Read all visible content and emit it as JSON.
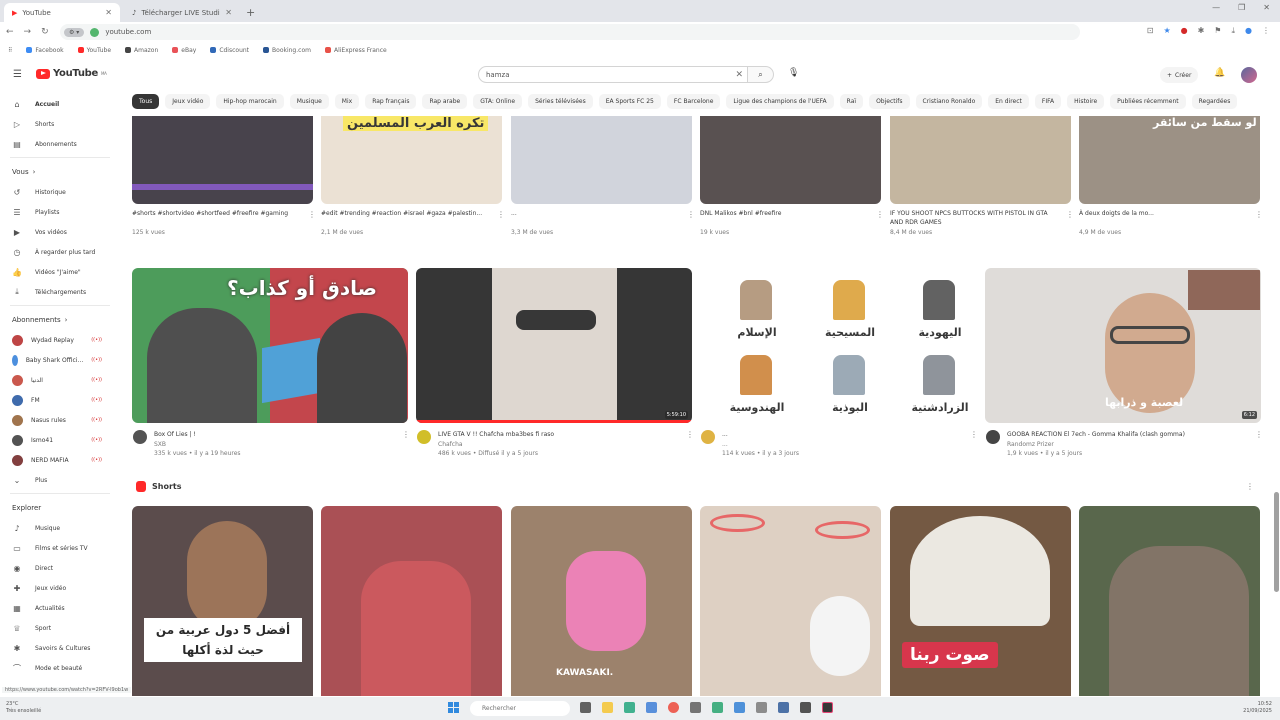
{
  "browser": {
    "tabs": [
      {
        "label": "YouTube",
        "active": true
      },
      {
        "label": "Télécharger LIVE Studio | TikTok",
        "active": false
      }
    ],
    "url": "youtube.com",
    "bookmarks": [
      "Facebook",
      "YouTube",
      "Amazon",
      "eBay",
      "Cdiscount",
      "Booking.com",
      "AliExpress France"
    ],
    "status_url": "https://www.youtube.com/watch?v=2RFV-l9ob1w"
  },
  "youtube": {
    "logo": "YouTube",
    "logo_region": "MA",
    "search_value": "hamza",
    "create_label": "Créer",
    "chips": [
      "Tous",
      "Jeux vidéo",
      "Hip-hop marocain",
      "Musique",
      "Mix",
      "Rap français",
      "Rap arabe",
      "GTA: Online",
      "Séries télévisées",
      "EA Sports FC 25",
      "FC Barcelone",
      "Ligue des champions de l'UEFA",
      "Raï",
      "Objectifs",
      "Cristiano Ronaldo",
      "En direct",
      "FIFA",
      "Histoire",
      "Publiées récemment",
      "Regardées"
    ]
  },
  "sidebar": {
    "main": [
      {
        "label": "Accueil",
        "icon": "home-icon",
        "active": true
      },
      {
        "label": "Shorts",
        "icon": "shorts-icon"
      },
      {
        "label": "Abonnements",
        "icon": "subscriptions-icon"
      }
    ],
    "you_header": "Vous",
    "you": [
      {
        "label": "Historique",
        "icon": "history-icon"
      },
      {
        "label": "Playlists",
        "icon": "playlist-icon"
      },
      {
        "label": "Vos vidéos",
        "icon": "video-icon"
      },
      {
        "label": "À regarder plus tard",
        "icon": "clock-icon"
      },
      {
        "label": "Vidéos \"J'aime\"",
        "icon": "like-icon"
      },
      {
        "label": "Téléchargements",
        "icon": "download-icon"
      }
    ],
    "subs_header": "Abonnements",
    "subs": [
      {
        "label": "Wydad Replay",
        "color": "#b22222"
      },
      {
        "label": "Baby Shark Offici...",
        "color": "#2a7ad8"
      },
      {
        "label": "الدنيا",
        "color": "#c0392b"
      },
      {
        "label": "FM",
        "color": "#1b4f9c"
      },
      {
        "label": "Nasus rules",
        "color": "#8e5a2b"
      },
      {
        "label": "Ismo41",
        "color": "#333333"
      },
      {
        "label": "NERD MAFIA",
        "color": "#6a1b1b"
      }
    ],
    "more_label": "Plus",
    "explore_header": "Explorer",
    "explore": [
      {
        "label": "Musique",
        "icon": "music-icon"
      },
      {
        "label": "Films et séries TV",
        "icon": "film-icon"
      },
      {
        "label": "Direct",
        "icon": "live-icon"
      },
      {
        "label": "Jeux vidéo",
        "icon": "gamepad-icon"
      },
      {
        "label": "Actualités",
        "icon": "news-icon"
      },
      {
        "label": "Sport",
        "icon": "trophy-icon"
      },
      {
        "label": "Savoirs & Cultures",
        "icon": "bulb-icon"
      },
      {
        "label": "Mode et beauté",
        "icon": "hanger-icon"
      }
    ]
  },
  "row1": [
    {
      "title": "#shorts #shortvideo #shortfeed #freefire #gaming",
      "views": "125 k vues",
      "thumb_text": "",
      "bg": "#26202a"
    },
    {
      "title": "#edit #trending #reaction #israel #gaza #palestin...",
      "views": "2,1 M de vues",
      "thumb_text": "تكره العرب المسلمين",
      "bg": "#e8dccc"
    },
    {
      "title": "...",
      "views": "3,3 M de vues",
      "thumb_text": "",
      "bg": "#c9ccd6"
    },
    {
      "title": "DNL Malikos #bnl #freefire",
      "views": "19 k vues",
      "thumb_text": "",
      "bg": "#3a3030"
    },
    {
      "title": "IF YOU SHOOT NPCS BUTTOCKS WITH PISTOL IN GTA AND RDR GAMES",
      "views": "8,4 M de vues",
      "thumb_text": "",
      "bg": "#b9a88e"
    },
    {
      "title": "À deux doigts de la mo...",
      "views": "4,9 M de vues",
      "thumb_text": "لو سقط من سائقر",
      "bg": "#8a7d6e"
    }
  ],
  "row2": [
    {
      "title": "Box Of Lies | !",
      "channel": "SXB",
      "views": "335 k vues • il y a 19 heures",
      "duration": "",
      "thumb_text": "صادق أو كذاب؟",
      "bg": "#2c8a3c",
      "av": "#333"
    },
    {
      "title": "LIVE GTA V !! Chafcha mba3bes fi raso",
      "channel": "Chafcha",
      "views": "486 k vues • Diffusé il y a 5 jours",
      "duration": "5:59:10",
      "thumb_text": "",
      "bg": "#101010",
      "av": "#c9b200"
    },
    {
      "title": "...",
      "channel": "...",
      "views": "114 k vues • il y a 3 jours",
      "duration": "",
      "thumb_text": "",
      "bg": "#ffffff",
      "av": "#d9a520"
    },
    {
      "title": "GOOBA REACTION El 7ech - Gomma Khalifa (clash gomma)",
      "channel": "Randomz Prizer",
      "views": "1,9 k vues • il y a 5 jours",
      "duration": "6:12",
      "thumb_text": "لعصبة و ذرابها",
      "bg": "#d9d6d2",
      "av": "#222"
    }
  ],
  "religions": [
    "الإسلام",
    "المسيحية",
    "اليهودية",
    "الهندوسية",
    "البوذية",
    "الزرادشتية"
  ],
  "shorts_title": "Shorts",
  "shorts": [
    {
      "text": "أفضل 5 دول عربية من حيث لذة أكلها",
      "bg": "#3c2a2a"
    },
    {
      "text": "",
      "bg": "#9a2f35"
    },
    {
      "text": "KAWASAKI.",
      "bg": "#8a6a50"
    },
    {
      "text": "",
      "bg": "#d8c8b8"
    },
    {
      "text": "صوت ربنا",
      "bg": "#5a3a20"
    },
    {
      "text": "",
      "bg": "#3a4a2a"
    }
  ],
  "taskbar": {
    "search": "Rechercher",
    "left_line1": "23°C",
    "left_line2": "Très ensoleillé",
    "time": "10:52",
    "date": "21/09/2025"
  }
}
